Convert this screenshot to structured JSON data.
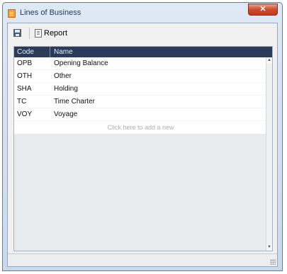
{
  "window": {
    "title": "Lines of Business",
    "close_symbol": "✕"
  },
  "toolbar": {
    "save_icon": "save-icon",
    "report_label": "Report",
    "report_icon": "report-icon"
  },
  "grid": {
    "columns": [
      "Code",
      "Name"
    ],
    "rows": [
      {
        "code": "OPB",
        "name": "Opening Balance"
      },
      {
        "code": "OTH",
        "name": "Other"
      },
      {
        "code": "SHA",
        "name": "Holding"
      },
      {
        "code": "TC",
        "name": "Time Charter"
      },
      {
        "code": "VOY",
        "name": "Voyage"
      }
    ],
    "add_row_text": "Click here to add a new"
  },
  "colors": {
    "header_bg": "#2c3a5a",
    "title_bar": "#c9d9ec",
    "close_button": "#d0492a"
  }
}
